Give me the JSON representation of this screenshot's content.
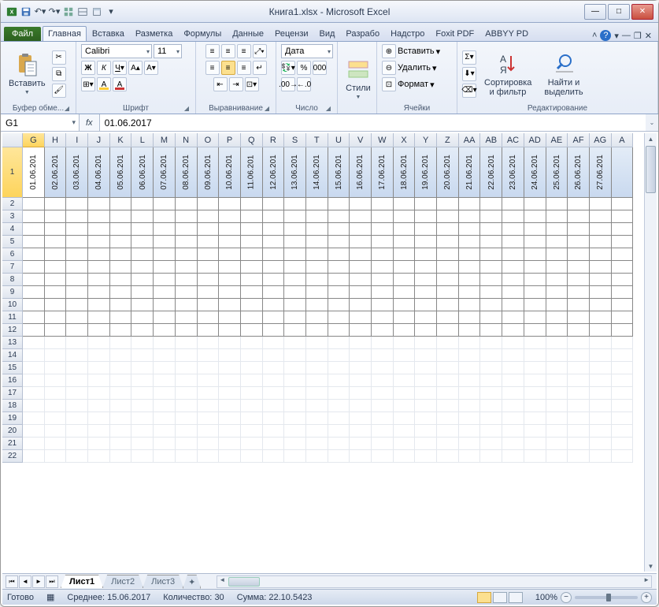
{
  "title": "Книга1.xlsx - Microsoft Excel",
  "tabs": {
    "file": "Файл",
    "items": [
      "Главная",
      "Вставка",
      "Разметка",
      "Формулы",
      "Данные",
      "Рецензи",
      "Вид",
      "Разрабо",
      "Надстро",
      "Foxit PDF",
      "ABBYY PD"
    ],
    "active": 0
  },
  "ribbon": {
    "clipboard": {
      "label": "Буфер обме...",
      "paste": "Вставить"
    },
    "font": {
      "label": "Шрифт",
      "name": "Calibri",
      "size": "11"
    },
    "align": {
      "label": "Выравнивание"
    },
    "number": {
      "label": "Число",
      "format": "Дата"
    },
    "styles": {
      "label": "",
      "btn": "Стили"
    },
    "cells": {
      "label": "Ячейки",
      "insert": "Вставить",
      "delete": "Удалить",
      "format": "Формат"
    },
    "editing": {
      "label": "Редактирование",
      "sort": "Сортировка и фильтр",
      "find": "Найти и выделить"
    }
  },
  "formulabar": {
    "namebox": "G1",
    "formula": "01.06.2017"
  },
  "columns": [
    "G",
    "H",
    "I",
    "J",
    "K",
    "L",
    "M",
    "N",
    "O",
    "P",
    "Q",
    "R",
    "S",
    "T",
    "U",
    "V",
    "W",
    "X",
    "Y",
    "Z",
    "AA",
    "AB",
    "AC",
    "AD",
    "AE",
    "AF",
    "AG",
    "A"
  ],
  "col_width": 27.7,
  "dates": [
    "01.06.201",
    "02.06.201",
    "03.06.201",
    "04.06.201",
    "05.06.201",
    "06.06.201",
    "07.06.201",
    "08.06.201",
    "09.06.201",
    "10.06.201",
    "11.06.201",
    "12.06.201",
    "13.06.201",
    "14.06.201",
    "15.06.201",
    "16.06.201",
    "17.06.201",
    "18.06.201",
    "19.06.201",
    "20.06.201",
    "21.06.201",
    "22.06.201",
    "23.06.201",
    "24.06.201",
    "25.06.201",
    "26.06.201",
    "27.06.201",
    ""
  ],
  "row_count_bordered": 11,
  "row_count_plain": 10,
  "sheets": {
    "active": "Лист1",
    "others": [
      "Лист2",
      "Лист3"
    ]
  },
  "status": {
    "ready": "Готово",
    "avg_lbl": "Среднее:",
    "avg": "15.06.2017",
    "count_lbl": "Количество:",
    "count": "30",
    "sum_lbl": "Сумма:",
    "sum": "22.10.5423",
    "zoom": "100%"
  }
}
